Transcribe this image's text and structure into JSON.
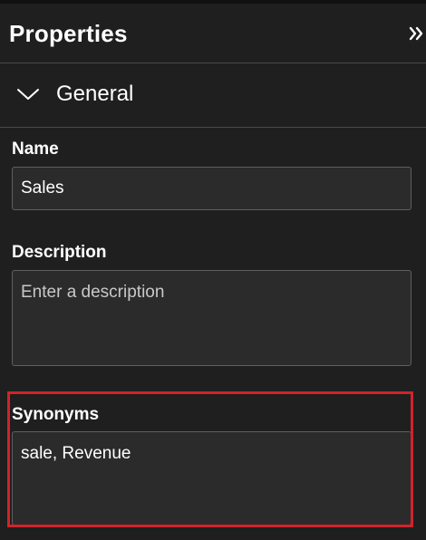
{
  "panel": {
    "title": "Properties",
    "collapse_icon": "double-chevron-right-icon"
  },
  "section": {
    "label": "General",
    "expanded": true,
    "chevron_icon": "chevron-down-icon"
  },
  "fields": {
    "name": {
      "label": "Name",
      "value": "Sales"
    },
    "description": {
      "label": "Description",
      "value": "",
      "placeholder": "Enter a description"
    },
    "synonyms": {
      "label": "Synonyms",
      "value": "sale, Revenue"
    }
  },
  "colors": {
    "background": "#1f1f1f",
    "field_background": "#2b2b2b",
    "field_border": "#5f5f5f",
    "divider": "#4a4a4a",
    "highlight": "#d1232a",
    "text": "#ffffff",
    "placeholder": "#c8c8c8"
  }
}
